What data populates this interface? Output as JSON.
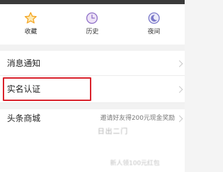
{
  "quick_actions": [
    {
      "label": "收藏",
      "icon": "star-icon"
    },
    {
      "label": "历史",
      "icon": "history-clock-icon"
    },
    {
      "label": "夜间",
      "icon": "night-mode-moon-icon"
    }
  ],
  "menu": {
    "notifications": {
      "title": "消息通知"
    },
    "verification": {
      "title": "实名认证"
    },
    "mall": {
      "title": "头条商城",
      "subtitle": "邀请好友得200元现金奖励"
    }
  },
  "partial_texts": {
    "overlay": "日出二门",
    "bottom": "新人领100元红包"
  },
  "colors": {
    "highlight_border": "#d9202a",
    "accent_icon": "#f5a623",
    "icon_purple": "#8e6fc7"
  }
}
